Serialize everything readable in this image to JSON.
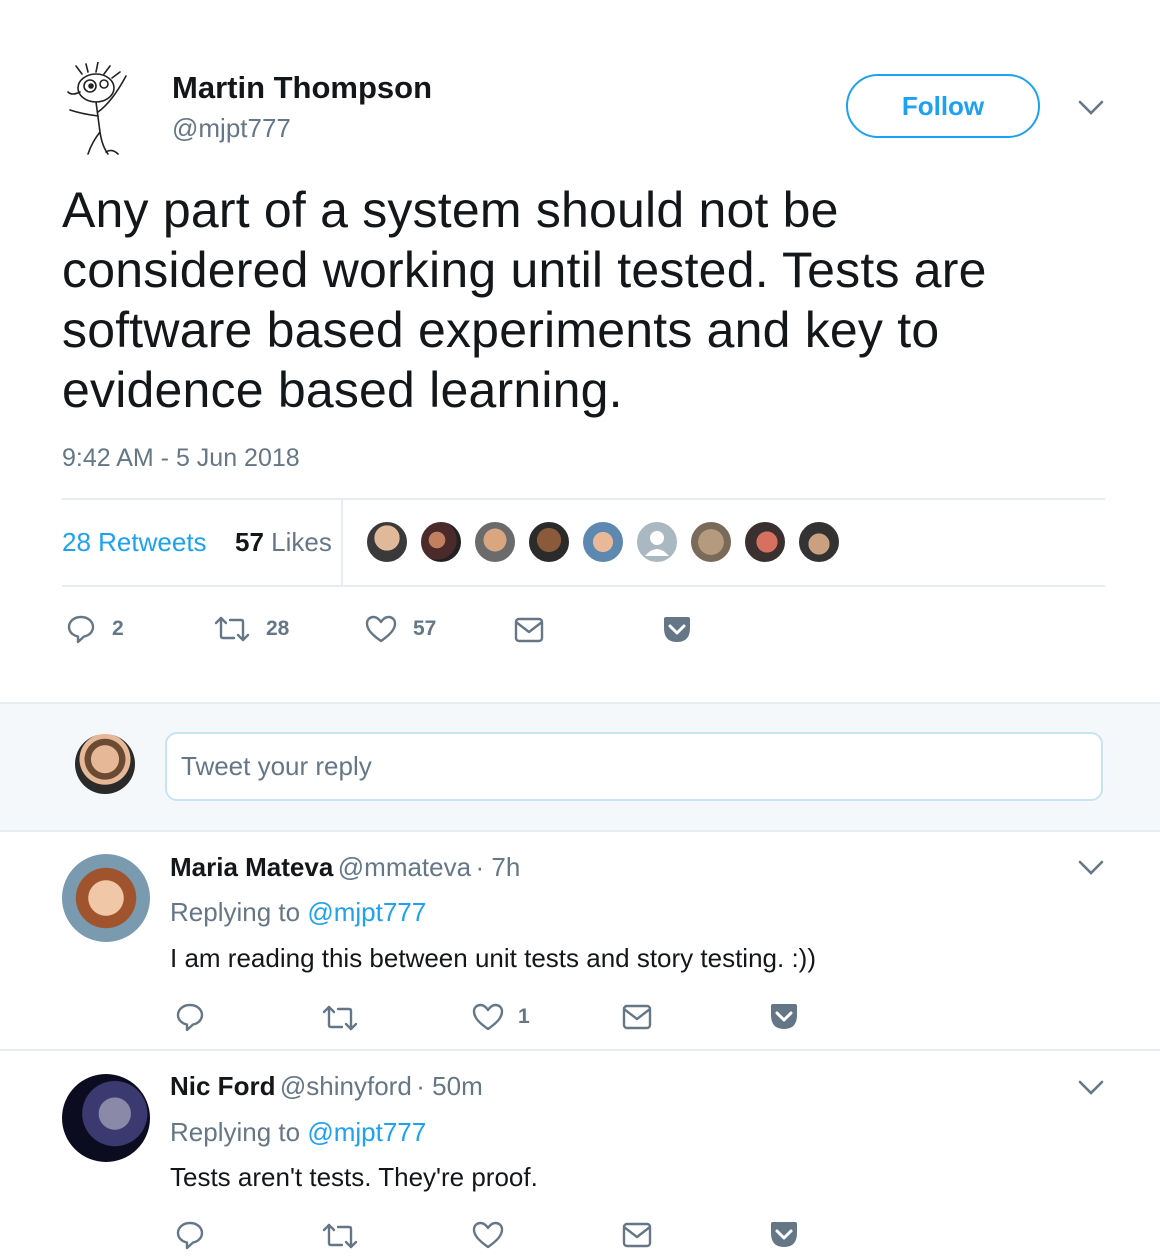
{
  "tweet": {
    "author_name": "Martin Thompson",
    "author_handle": "@mjpt777",
    "follow_label": "Follow",
    "text": "Any part of a system should not be considered working until tested. Tests are software based experiments and key to evidence based learning.",
    "timestamp": "9:42 AM - 5 Jun 2018",
    "retweets_count": "28",
    "retweets_label": "Retweets",
    "likes_count": "57",
    "likes_label": "Likes",
    "actions": {
      "reply_count": "2",
      "retweet_count": "28",
      "like_count": "57"
    }
  },
  "reply_box": {
    "placeholder": "Tweet your reply"
  },
  "replies": [
    {
      "name": "Maria Mateva",
      "handle": "@mmateva",
      "time": "· 7h",
      "replying_prefix": "Replying to",
      "replying_to": "@mjpt777",
      "text": "I am reading this between unit tests and story testing. :))",
      "like_count": "1"
    },
    {
      "name": "Nic Ford",
      "handle": "@shinyford",
      "time": "· 50m",
      "replying_prefix": "Replying to",
      "replying_to": "@mjpt777",
      "text": "Tests aren't tests. They're proof.",
      "like_count": ""
    }
  ],
  "colors": {
    "accent": "#1da1f2",
    "muted": "#657786",
    "text": "#14171a",
    "border": "#e6ecf0",
    "band": "#f5f8fa"
  },
  "icons": [
    "reply-icon",
    "retweet-icon",
    "like-icon",
    "dm-icon",
    "pocket-icon",
    "chevron-down-icon"
  ]
}
